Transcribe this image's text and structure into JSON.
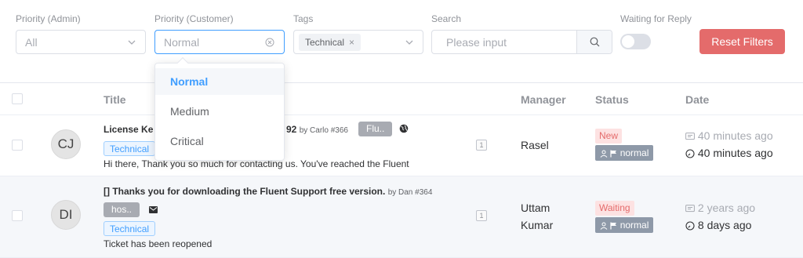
{
  "filters": {
    "priority_admin": {
      "label": "Priority (Admin)",
      "value": "All"
    },
    "priority_customer": {
      "label": "Priority (Customer)",
      "placeholder": "Normal"
    },
    "tags": {
      "label": "Tags",
      "selected": "Technical"
    },
    "search": {
      "label": "Search",
      "placeholder": "Please input"
    },
    "waiting": {
      "label": "Waiting for Reply",
      "on": false
    },
    "reset_label": "Reset Filters"
  },
  "dropdown": {
    "options": [
      "Normal",
      "Medium",
      "Critical"
    ],
    "selected": "Normal"
  },
  "table": {
    "headers": {
      "title": "Title",
      "manager": "Manager",
      "status": "Status",
      "date": "Date"
    },
    "rows": [
      {
        "avatar": "CJ",
        "title": "License Ke",
        "title_tail": "92",
        "by": "by Carlo #366",
        "product_tag": "Flu..",
        "tag": "Technical",
        "excerpt": "Hi there, Thank you so much for contacting us. You've reached the Fluent",
        "count": "1",
        "manager_line1": "Rasel",
        "manager_line2": "",
        "status": "New",
        "priority": "normal",
        "date_created": "40 minutes ago",
        "date_updated": "40 minutes ago"
      },
      {
        "avatar": "DI",
        "title": "[] Thanks you for downloading the Fluent Support free version.",
        "by": "by Dan #364",
        "product_tag": "hos..",
        "tag": "Technical",
        "excerpt": "Ticket has been reopened",
        "count": "1",
        "manager_line1": "Uttam",
        "manager_line2": "Kumar",
        "status": "Waiting",
        "priority": "normal",
        "date_created": "2 years ago",
        "date_updated": "8 days ago"
      }
    ]
  },
  "colors": {
    "accent": "#409eff",
    "danger": "#e46b6b",
    "muted": "#909399"
  }
}
